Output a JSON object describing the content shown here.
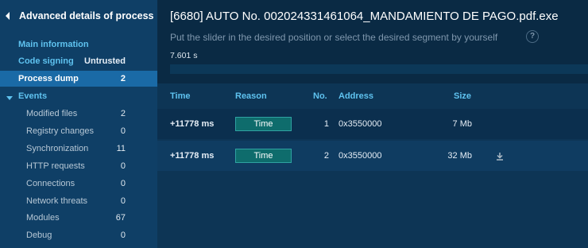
{
  "sidebar": {
    "title": "Advanced details of process",
    "main_information": "Main information",
    "code_signing": {
      "label": "Code signing",
      "value": "Untrusted"
    },
    "process_dump": {
      "label": "Process dump",
      "value": "2"
    },
    "events_label": "Events",
    "events": [
      {
        "label": "Modified files",
        "value": "2"
      },
      {
        "label": "Registry changes",
        "value": "0"
      },
      {
        "label": "Synchronization",
        "value": "11"
      },
      {
        "label": "HTTP requests",
        "value": "0"
      },
      {
        "label": "Connections",
        "value": "0"
      },
      {
        "label": "Network threats",
        "value": "0"
      },
      {
        "label": "Modules",
        "value": "67"
      },
      {
        "label": "Debug",
        "value": "0"
      }
    ]
  },
  "main": {
    "title": "[6680] AUTO No. 002024331461064_MANDAMIENTO DE PAGO.pdf.exe",
    "hint": "Put the slider in the desired position or select the desired segment by yourself",
    "help_glyph": "?",
    "time_readout": "7.601 s",
    "slider_fraction": 0.0
  },
  "table": {
    "headers": {
      "time": "Time",
      "reason": "Reason",
      "no": "No.",
      "address": "Address",
      "size": "Size"
    },
    "rows": [
      {
        "time": "+11778 ms",
        "reason": "Time",
        "no": "1",
        "address": "0x3550000",
        "size": "7 Mb",
        "download": false
      },
      {
        "time": "+11778 ms",
        "reason": "Time",
        "no": "2",
        "address": "0x3550000",
        "size": "32 Mb",
        "download": true
      }
    ]
  },
  "colors": {
    "sidebar_bg": "#0f3f66",
    "sidebar_active": "#1a6aa6",
    "accent": "#5fc3f0",
    "badge_bg": "#0e6c6c",
    "page_bg": "#0a2a44"
  },
  "icons": {
    "back": "chevron-left-icon",
    "events_toggle": "caret-down-icon",
    "help": "help-circle-icon",
    "download": "download-icon"
  }
}
